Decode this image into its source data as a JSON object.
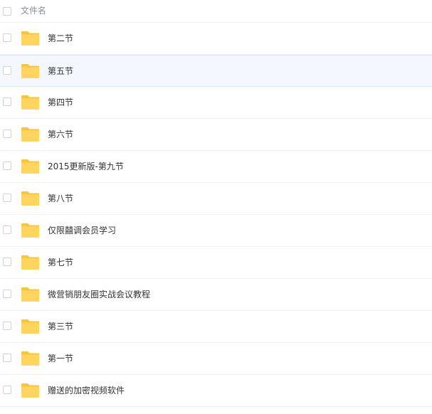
{
  "header": {
    "column_label": "文件名"
  },
  "files": [
    {
      "name": "第二节",
      "icon": "folder-icon",
      "selected": false
    },
    {
      "name": "第五节",
      "icon": "folder-icon",
      "selected": true
    },
    {
      "name": "第四节",
      "icon": "folder-icon",
      "selected": false
    },
    {
      "name": "第六节",
      "icon": "folder-icon",
      "selected": false
    },
    {
      "name": "2015更新版-第九节",
      "icon": "folder-icon",
      "selected": false
    },
    {
      "name": "第八节",
      "icon": "folder-icon",
      "selected": false
    },
    {
      "name": "仅限囍调会员学习",
      "icon": "folder-icon",
      "selected": false
    },
    {
      "name": "第七节",
      "icon": "folder-icon",
      "selected": false
    },
    {
      "name": "微营销朋友圈实战会议教程",
      "icon": "folder-icon",
      "selected": false
    },
    {
      "name": "第三节",
      "icon": "folder-icon",
      "selected": false
    },
    {
      "name": "第一节",
      "icon": "folder-icon",
      "selected": false
    },
    {
      "name": "赠送的加密视频软件",
      "icon": "folder-icon",
      "selected": false
    }
  ],
  "colors": {
    "folder": "#ffd560",
    "folder_back": "#f7c544",
    "selected_row": "#f4f8fe"
  }
}
